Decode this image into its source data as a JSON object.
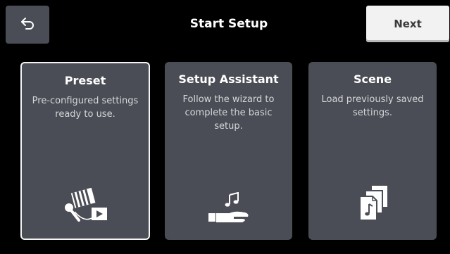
{
  "header": {
    "title": "Start Setup",
    "next_label": "Next"
  },
  "cards": [
    {
      "title": "Preset",
      "description": "Pre-configured settings ready to use.",
      "icon": "mic-keyboard-video-icon",
      "selected": true
    },
    {
      "title": "Setup Assistant",
      "description": "Follow the wizard to complete the basic setup.",
      "icon": "hand-music-note-icon",
      "selected": false
    },
    {
      "title": "Scene",
      "description": "Load previously saved settings.",
      "icon": "stacked-documents-icon",
      "selected": false
    }
  ],
  "colors": {
    "background": "#000000",
    "card": "#4a4d55",
    "next_button": "#f2f2f2",
    "selected_border": "#f5f5f5"
  }
}
